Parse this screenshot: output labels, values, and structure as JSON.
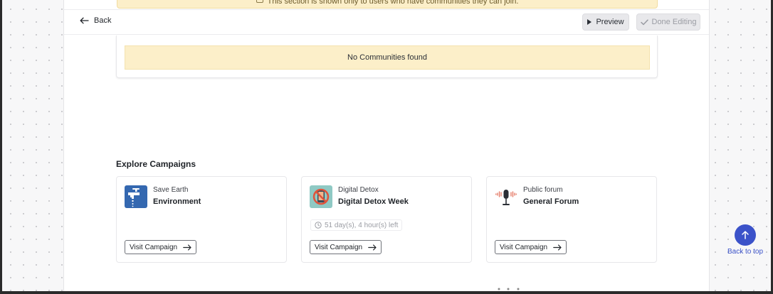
{
  "notice": {
    "text": "This section is shown only to users who have communities they can join."
  },
  "topbar": {
    "back_label": "Back",
    "preview_label": "Preview",
    "done_label": "Done Editing"
  },
  "communities": {
    "empty_text": "No Communities found"
  },
  "campaigns": {
    "title": "Explore Campaigns",
    "items": [
      {
        "category": "Save Earth",
        "name": "Environment",
        "timer": "",
        "visit_label": "Visit Campaign",
        "icon": "water-tap-icon"
      },
      {
        "category": "Digital Detox",
        "name": "Digital Detox Week",
        "timer": "51 day(s), 4 hour(s) left",
        "visit_label": "Visit Campaign",
        "icon": "no-phone-icon"
      },
      {
        "category": "Public forum",
        "name": "General Forum",
        "timer": "",
        "visit_label": "Visit Campaign",
        "icon": "microphone-icon"
      }
    ]
  },
  "back_to_top": {
    "label": "Back to top"
  },
  "colors": {
    "accent": "#3b52c9",
    "notice_bg": "#fcefc9",
    "env_icon_bg": "#3468b0",
    "detox_icon_bg": "#8fc9c4"
  }
}
